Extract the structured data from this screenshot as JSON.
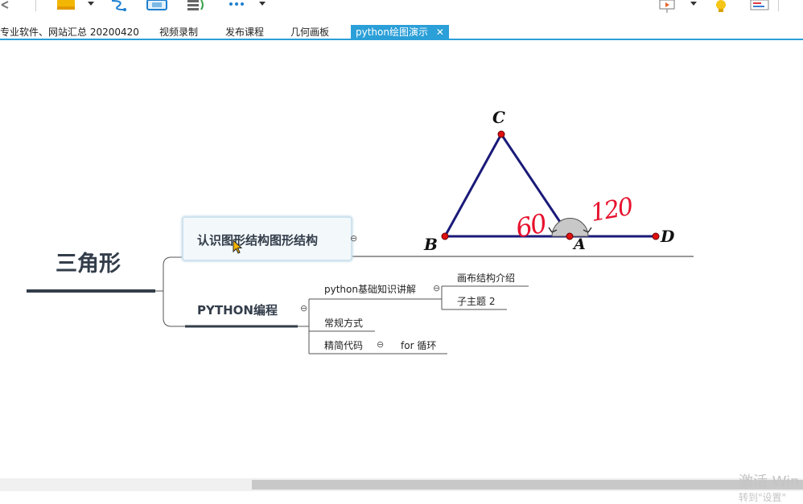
{
  "tabs": [
    {
      "label": "专业软件、网站汇总 20200420"
    },
    {
      "label": "视频录制"
    },
    {
      "label": "发布课程"
    },
    {
      "label": "几何画板"
    },
    {
      "label": "python绘图演示",
      "active": true
    }
  ],
  "tab_close_glyph": "✕",
  "mindmap": {
    "central": "三角形",
    "topic1": "认识图形结构图形结构",
    "topic2": "PYTHON编程",
    "sub_basics": "python基础知识讲解",
    "sub_layout": "画布结构介绍",
    "sub_topic2": "子主题 2",
    "sub_regular": "常规方式",
    "sub_concise": "精简代码",
    "sub_loop": "for 循环",
    "collapse_glyph": "⊖"
  },
  "geometry": {
    "labels": {
      "A": "A",
      "B": "B",
      "C": "C",
      "D": "D"
    },
    "handwritten": {
      "angle_left": "60",
      "angle_right": "120"
    }
  },
  "watermark": {
    "line1": "激活 Win",
    "line2": "转到\"设置\""
  },
  "colors": {
    "accent": "#2b9fd8",
    "triangle": "#1a1a7a",
    "point": "#e01010",
    "ink": "#e8112d",
    "node_text": "#333d4a"
  }
}
